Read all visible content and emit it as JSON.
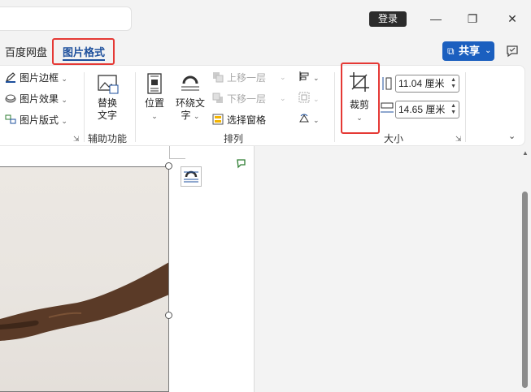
{
  "titlebar": {
    "login_label": "登录",
    "minimize_icon": "minimize-icon",
    "restore_icon": "restore-icon",
    "close_icon": "close-icon"
  },
  "tabs": {
    "baidu": "百度网盘",
    "picture_format": "图片格式",
    "share_label": "共享",
    "comment_icon": "comment-icon"
  },
  "ribbon": {
    "picture_border": "图片边框",
    "picture_effects": "图片效果",
    "picture_layout": "图片版式",
    "alt_text_line1": "替换",
    "alt_text_line2": "文字",
    "accessibility_label": "辅助功能",
    "position_label": "位置",
    "wrap_text_line1": "环绕文",
    "wrap_text_line2": "字",
    "bring_forward": "上移一层",
    "send_backward": "下移一层",
    "selection_pane": "选择窗格",
    "arrange_label": "排列",
    "crop_label": "裁剪",
    "height_value": "11.04 厘米",
    "width_value": "14.65 厘米",
    "size_label": "大小"
  },
  "colors": {
    "accent": "#1d4f9c",
    "share_bg": "#1b5fbf",
    "highlight": "#e53935"
  }
}
